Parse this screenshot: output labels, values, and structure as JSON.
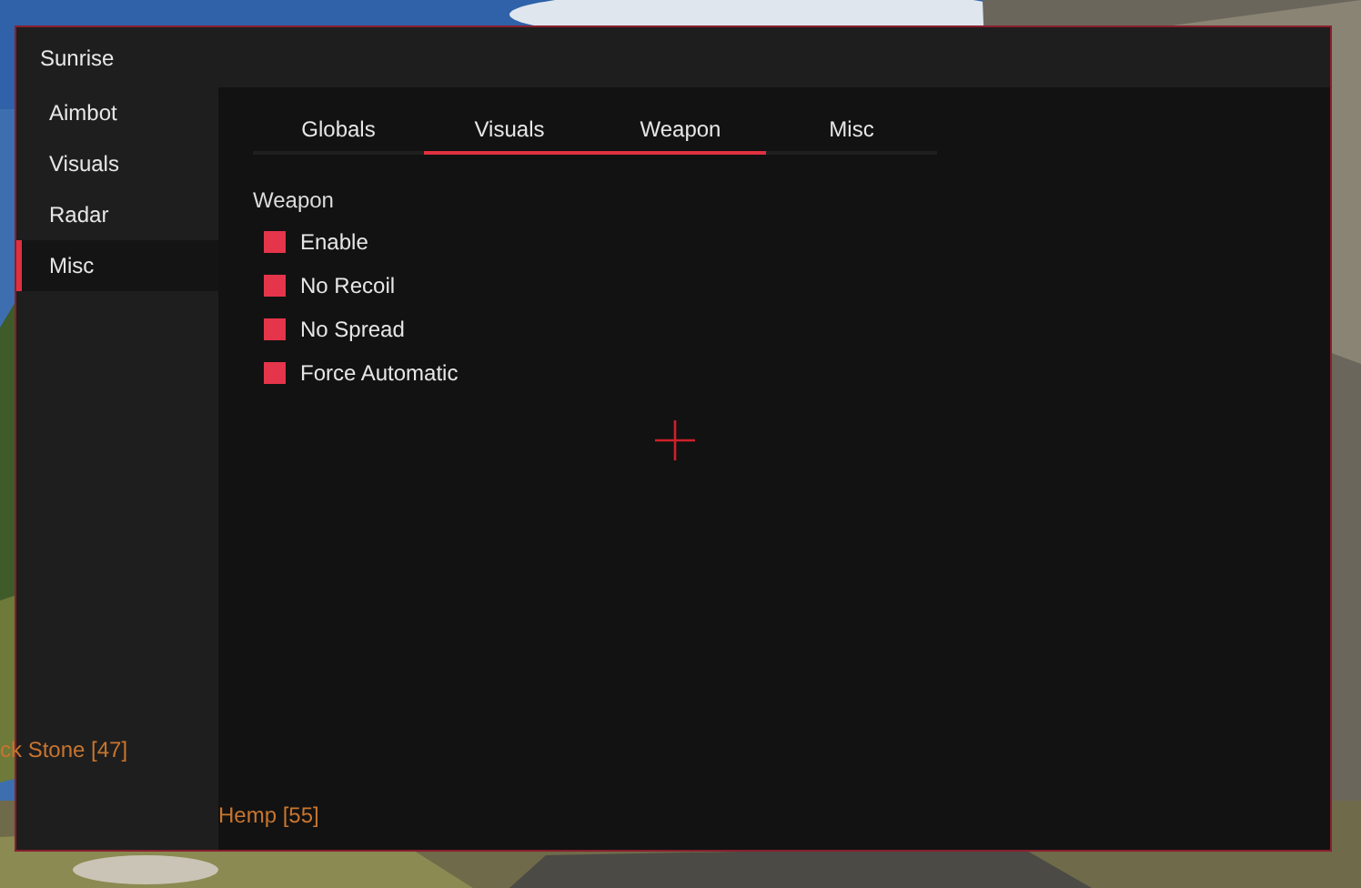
{
  "window": {
    "title": "Sunrise"
  },
  "sidebar": {
    "items": [
      {
        "label": "Aimbot",
        "selected": false
      },
      {
        "label": "Visuals",
        "selected": false
      },
      {
        "label": "Radar",
        "selected": false
      },
      {
        "label": "Misc",
        "selected": true
      }
    ]
  },
  "tabs": [
    {
      "label": "Globals",
      "selected": false
    },
    {
      "label": "Visuals",
      "selected": true
    },
    {
      "label": "Weapon",
      "selected": true
    },
    {
      "label": "Misc",
      "selected": false
    }
  ],
  "section": {
    "title": "Weapon",
    "options": [
      {
        "label": "Enable",
        "checked": true
      },
      {
        "label": "No Recoil",
        "checked": true
      },
      {
        "label": "No Spread",
        "checked": true
      },
      {
        "label": "Force Automatic",
        "checked": true
      }
    ]
  },
  "esp_labels": [
    "ck Stone [47]",
    "Hemp [55]"
  ]
}
